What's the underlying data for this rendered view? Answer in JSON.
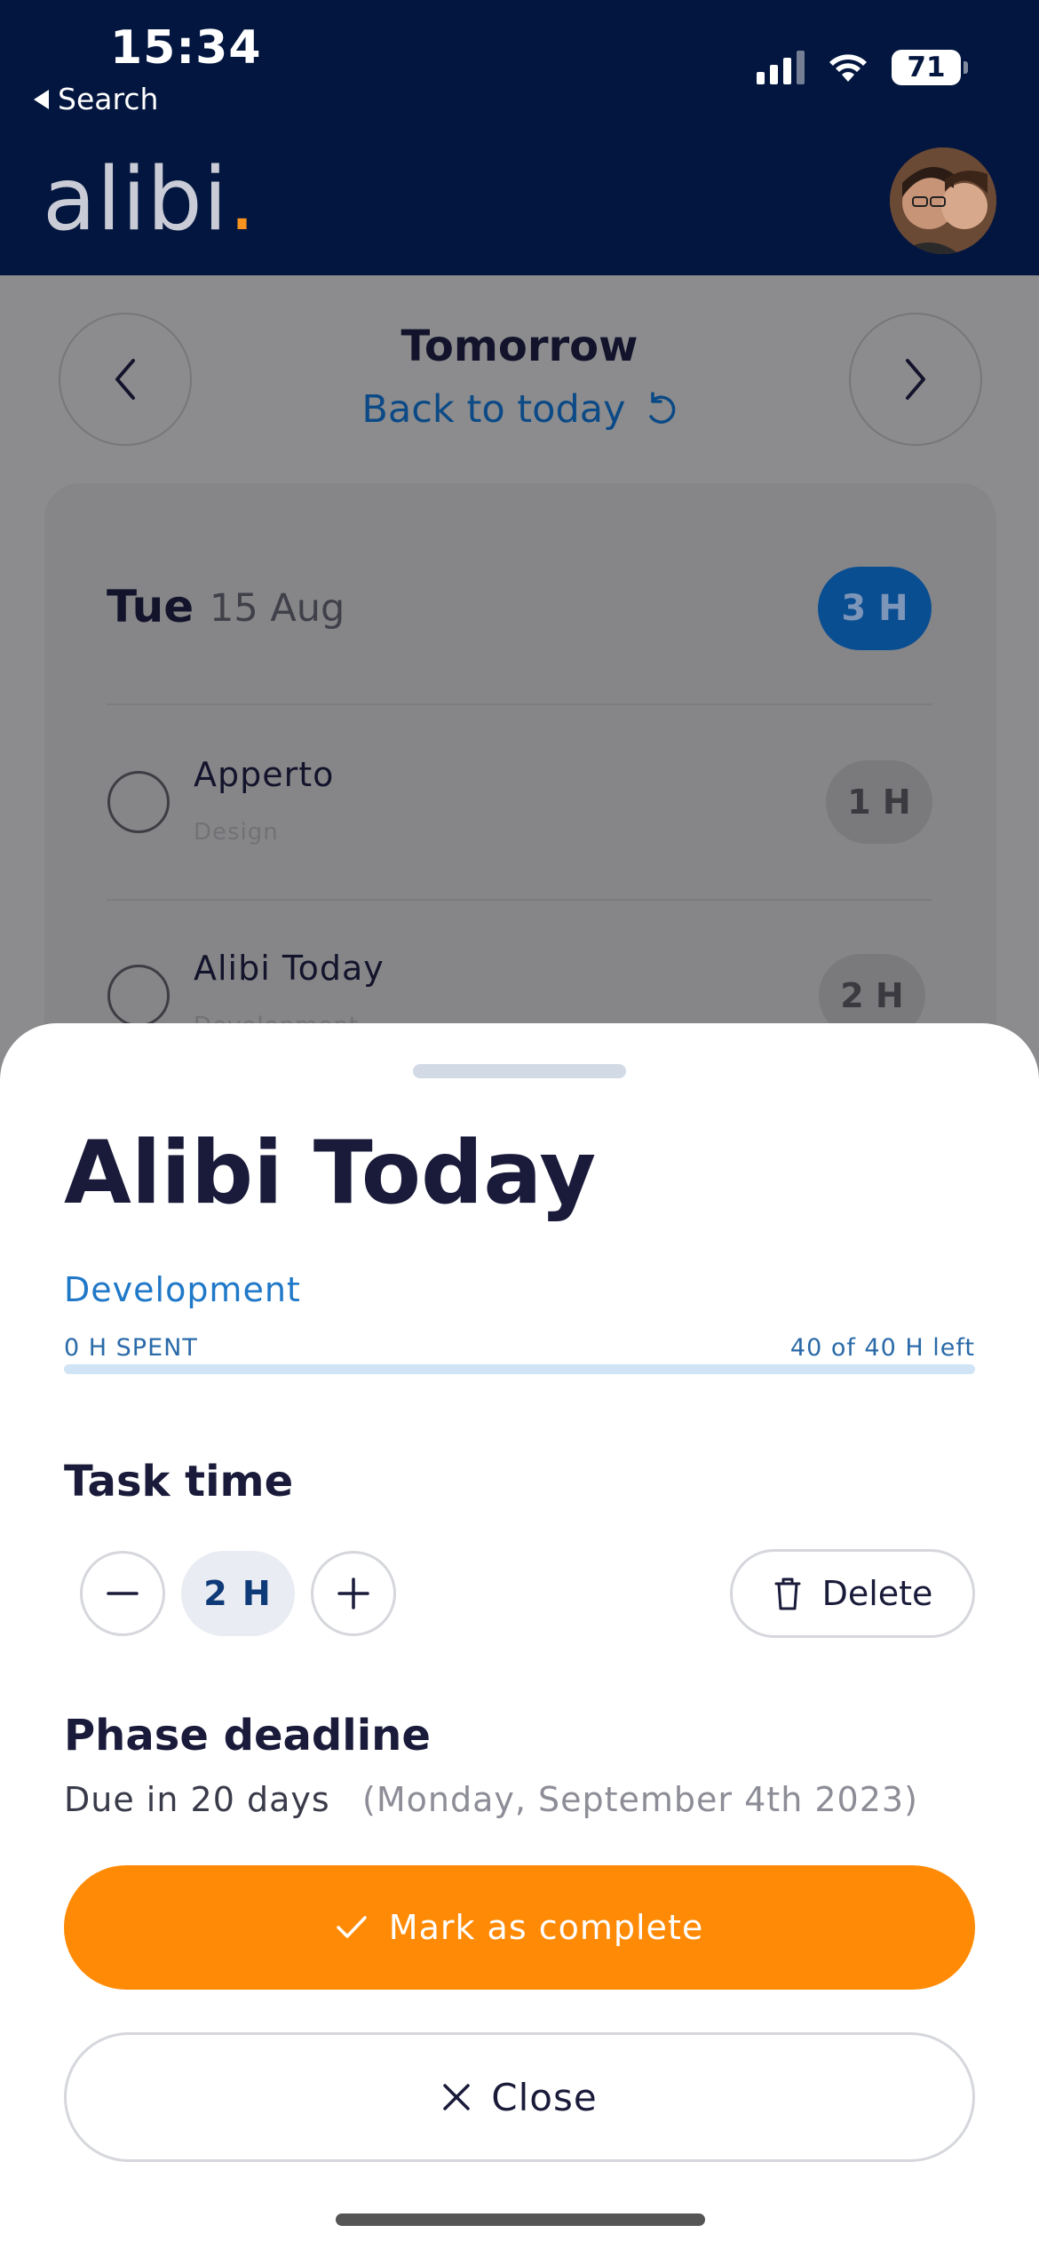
{
  "status_bar": {
    "time": "15:34",
    "back_label": "Search",
    "battery": "71"
  },
  "header": {
    "logo": "alibi",
    "logo_dot": "."
  },
  "day_nav": {
    "title": "Tomorrow",
    "back_to_today": "Back to today"
  },
  "day_card": {
    "day": "Tue",
    "date": "15 Aug",
    "total_hours": "3 H",
    "tasks": [
      {
        "name": "Apperto",
        "phase": "Design",
        "hours": "1 H"
      },
      {
        "name": "Alibi Today",
        "phase": "Development",
        "hours": "2 H"
      }
    ]
  },
  "sheet": {
    "title": "Alibi Today",
    "phase": "Development",
    "spent": "0 H SPENT",
    "left": "40 of 40 H left",
    "progress_fraction": 0.0,
    "task_time_heading": "Task time",
    "task_time_value": "2 H",
    "delete_label": "Delete",
    "deadline_heading": "Phase deadline",
    "due_text": "Due in 20 days",
    "due_date": "(Monday, September 4th 2023)",
    "complete_label": "Mark as complete",
    "close_label": "Close"
  },
  "colors": {
    "navy": "#03163f",
    "accent_orange": "#ff8a05",
    "link_blue": "#1f78c8"
  }
}
